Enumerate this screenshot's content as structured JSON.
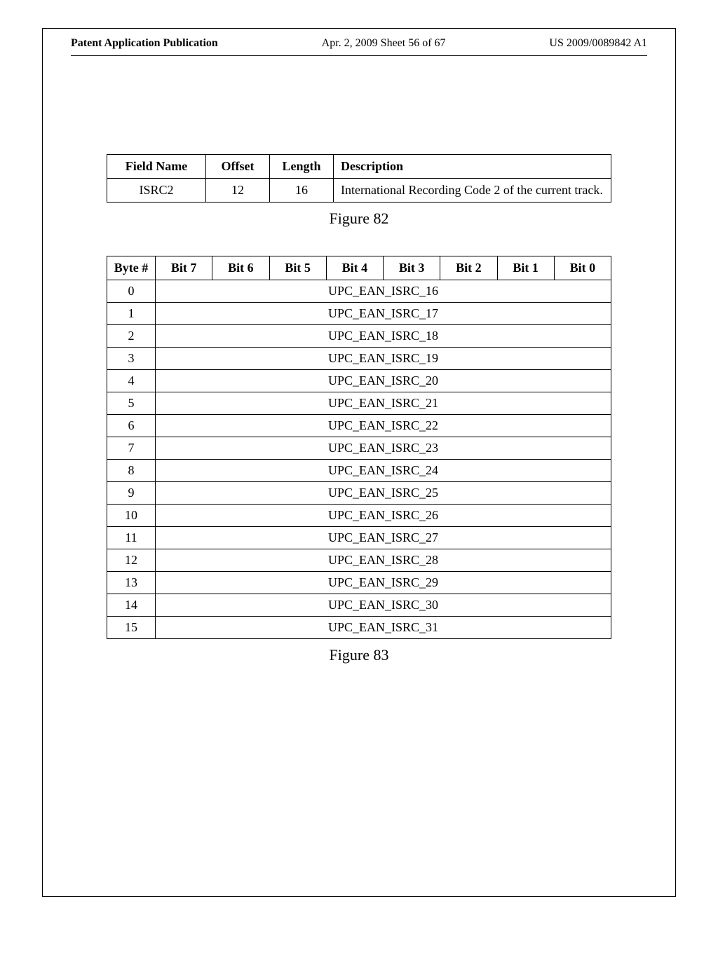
{
  "header": {
    "left": "Patent Application Publication",
    "center": "Apr. 2, 2009  Sheet 56 of 67",
    "right": "US 2009/0089842 A1"
  },
  "table1": {
    "headers": [
      "Field Name",
      "Offset",
      "Length",
      "Description"
    ],
    "rows": [
      {
        "field": "ISRC2",
        "offset": "12",
        "length": "16",
        "desc": "International Recording Code 2 of the current track."
      }
    ]
  },
  "figure82": "Figure 82",
  "table2": {
    "headers": [
      "Byte #",
      "Bit 7",
      "Bit 6",
      "Bit 5",
      "Bit 4",
      "Bit 3",
      "Bit 2",
      "Bit 1",
      "Bit 0"
    ],
    "rows": [
      {
        "byte": "0",
        "val": "UPC_EAN_ISRC_16"
      },
      {
        "byte": "1",
        "val": "UPC_EAN_ISRC_17"
      },
      {
        "byte": "2",
        "val": "UPC_EAN_ISRC_18"
      },
      {
        "byte": "3",
        "val": "UPC_EAN_ISRC_19"
      },
      {
        "byte": "4",
        "val": "UPC_EAN_ISRC_20"
      },
      {
        "byte": "5",
        "val": "UPC_EAN_ISRC_21"
      },
      {
        "byte": "6",
        "val": "UPC_EAN_ISRC_22"
      },
      {
        "byte": "7",
        "val": "UPC_EAN_ISRC_23"
      },
      {
        "byte": "8",
        "val": "UPC_EAN_ISRC_24"
      },
      {
        "byte": "9",
        "val": "UPC_EAN_ISRC_25"
      },
      {
        "byte": "10",
        "val": "UPC_EAN_ISRC_26"
      },
      {
        "byte": "11",
        "val": "UPC_EAN_ISRC_27"
      },
      {
        "byte": "12",
        "val": "UPC_EAN_ISRC_28"
      },
      {
        "byte": "13",
        "val": "UPC_EAN_ISRC_29"
      },
      {
        "byte": "14",
        "val": "UPC_EAN_ISRC_30"
      },
      {
        "byte": "15",
        "val": "UPC_EAN_ISRC_31"
      }
    ]
  },
  "figure83": "Figure 83"
}
